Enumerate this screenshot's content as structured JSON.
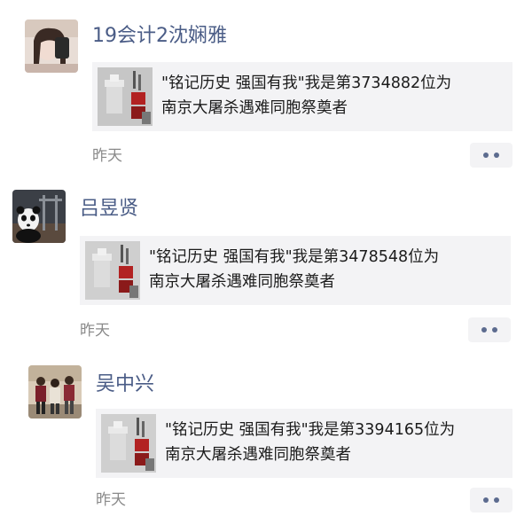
{
  "posts": [
    {
      "username": "19会计2沈娴雅",
      "avatar_icon": "avatar-girl-photo",
      "share": {
        "line1": "\"铭记历史 强国有我\"我是第3734882位为",
        "line2": "南京大屠杀遇难同胞祭奠者"
      },
      "thumbnail_icon": "memorial-poster-thumbnail",
      "timestamp": "昨天",
      "more_icon": "more-dots-icon"
    },
    {
      "username": "吕昱贤",
      "avatar_icon": "avatar-panda-photo",
      "share": {
        "line1": "\"铭记历史 强国有我\"我是第3478548位为",
        "line2": "南京大屠杀遇难同胞祭奠者"
      },
      "thumbnail_icon": "memorial-poster-thumbnail",
      "timestamp": "昨天",
      "more_icon": "more-dots-icon"
    },
    {
      "username": "吴中兴",
      "avatar_icon": "avatar-group-photo",
      "share": {
        "line1": "\"铭记历史 强国有我\"我是第3394165位为",
        "line2": "南京大屠杀遇难同胞祭奠者"
      },
      "thumbnail_icon": "memorial-poster-thumbnail",
      "timestamp": "昨天",
      "more_icon": "more-dots-icon"
    }
  ],
  "colors": {
    "username": "#4a5c86",
    "card_background": "#f3f3f5",
    "timestamp": "#8a8a8a",
    "dots": "#5c6b8f"
  }
}
